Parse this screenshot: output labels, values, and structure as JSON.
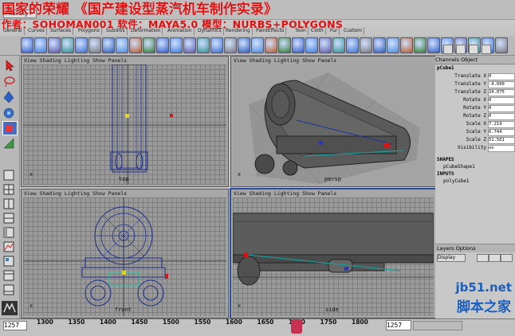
{
  "banner": {
    "title": "国家的荣耀  《国产建设型蒸汽机车制作实录》",
    "author": "作者：SOHOMAN001  软件：MAYA5.0  模型：NURBS+POLYGONS"
  },
  "menu": {
    "mode": "Modeling"
  },
  "shelf_tabs": [
    "General",
    "Curves",
    "Surfaces",
    "Polygons",
    "Subdivs",
    "Deformation",
    "Animation",
    "Dynamics",
    "Rendering",
    "PaintEffects",
    "Toon",
    "Cloth",
    "Fur",
    "Custom"
  ],
  "panels": {
    "menu_items": "View  Shading  Lighting  Show  Panels",
    "top_label": "top",
    "persp_label": "persp",
    "front_label": "front",
    "side_label": "side"
  },
  "channel_box": {
    "header": "Channels  Object",
    "object_name": "pCube1",
    "attributes": [
      {
        "name": "Translate X",
        "value": "0"
      },
      {
        "name": "Translate Y",
        "value": "-4.600"
      },
      {
        "name": "Translate Z",
        "value": "24.075"
      },
      {
        "name": "Rotate X",
        "value": "0"
      },
      {
        "name": "Rotate Y",
        "value": "0"
      },
      {
        "name": "Rotate Z",
        "value": "0"
      },
      {
        "name": "Scale X",
        "value": "7.219"
      },
      {
        "name": "Scale Y",
        "value": "6.744"
      },
      {
        "name": "Scale Z",
        "value": "51.561"
      },
      {
        "name": "Visibility",
        "value": "on"
      }
    ],
    "shapes_label": "SHAPES",
    "shape_name": "pCubeShape1",
    "inputs_label": "INPUTS",
    "input_name": "polyCube1",
    "layers_label": "Layers  Options",
    "layer_mode": "Display"
  },
  "timeline": {
    "start": "1257",
    "ticks": [
      "1300",
      "1350",
      "1400",
      "1450",
      "1500",
      "1550",
      "1600",
      "1650",
      "1700",
      "1750",
      "1800"
    ],
    "current": "1257"
  },
  "watermark": {
    "site": "jb51.net",
    "name": "脚本之家"
  }
}
